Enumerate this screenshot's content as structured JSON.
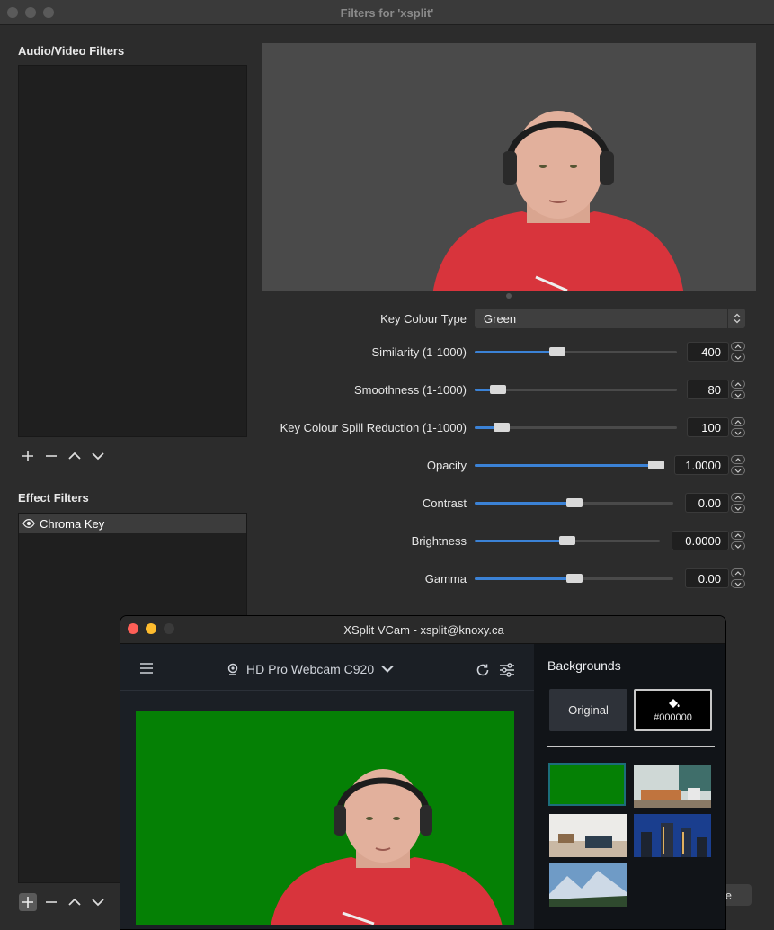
{
  "obs": {
    "title": "Filters for 'xsplit'",
    "audio_video_label": "Audio/Video Filters",
    "effect_label": "Effect Filters",
    "effect_items": [
      {
        "label": "Chroma Key"
      }
    ],
    "close_partial": "e",
    "properties": {
      "key_colour_type": {
        "label": "Key Colour Type",
        "value": "Green"
      },
      "similarity": {
        "label": "Similarity (1-1000)",
        "value": "400",
        "fraction": 0.4
      },
      "smoothness": {
        "label": "Smoothness (1-1000)",
        "value": "80",
        "fraction": 0.08
      },
      "spill": {
        "label": "Key Colour Spill Reduction (1-1000)",
        "value": "100",
        "fraction": 0.1
      },
      "opacity": {
        "label": "Opacity",
        "value": "1.0000",
        "fraction": 1.0
      },
      "contrast": {
        "label": "Contrast",
        "value": "0.00",
        "fraction": 0.5
      },
      "brightness": {
        "label": "Brightness",
        "value": "0.0000",
        "fraction": 0.5
      },
      "gamma": {
        "label": "Gamma",
        "value": "0.00",
        "fraction": 0.5
      }
    }
  },
  "vcam": {
    "title": "XSplit VCam - xsplit@knoxy.ca",
    "camera": "HD Pro Webcam C920",
    "backgrounds_label": "Backgrounds",
    "original_label": "Original",
    "color_label": "#000000"
  },
  "colors": {
    "accent": "#3b82d6",
    "chroma_green": "#058005"
  }
}
